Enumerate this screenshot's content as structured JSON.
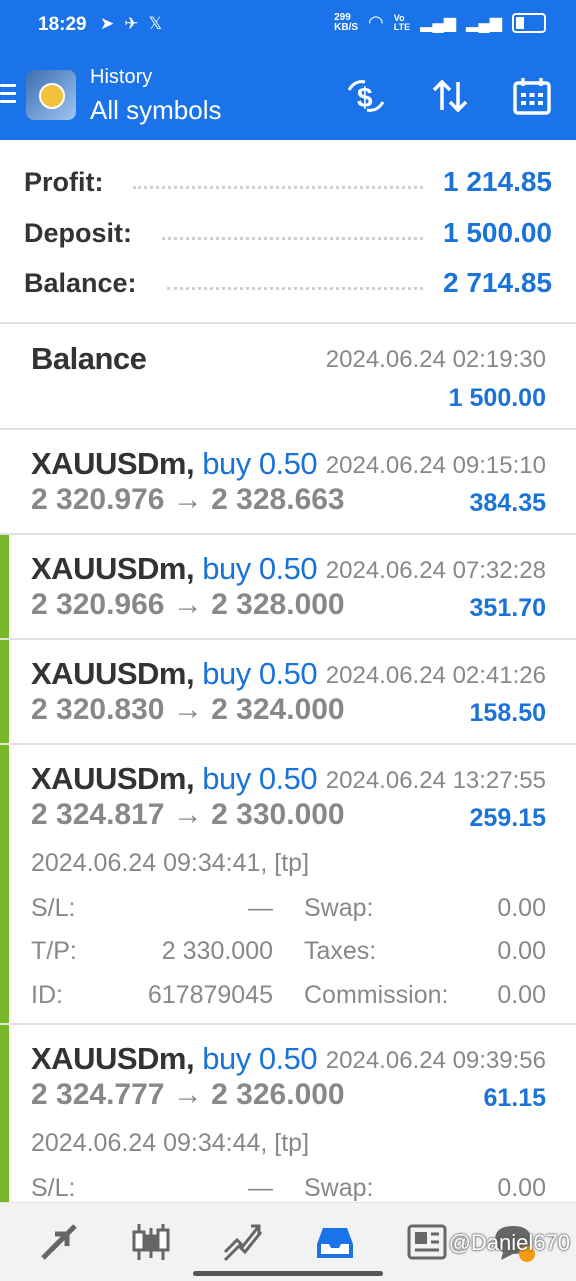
{
  "status_bar": {
    "time": "18:29",
    "net_speed": "299\nKB/S",
    "volte": "Vo\nLTE",
    "app_icons": [
      "telegram-icon",
      "telegram-send-icon",
      "x-icon"
    ]
  },
  "header": {
    "subtitle": "History",
    "title": "All symbols",
    "buttons": [
      "dollar-exchange-icon",
      "sort-icon",
      "calendar-icon"
    ]
  },
  "summary": {
    "profit_label": "Profit:",
    "profit_value": "1 214.85",
    "deposit_label": "Deposit:",
    "deposit_value": "1 500.00",
    "balance_label": "Balance:",
    "balance_value": "2 714.85"
  },
  "balance_entry": {
    "title": "Balance",
    "date": "2024.06.24 02:19:30",
    "amount": "1 500.00"
  },
  "trades": [
    {
      "symbol": "XAUUSDm,",
      "type": "buy 0.50",
      "date": "2024.06.24 09:15:10",
      "open": "2 320.976",
      "arrow": "→",
      "close": "2 328.663",
      "profit": "384.35"
    },
    {
      "symbol": "XAUUSDm,",
      "type": "buy 0.50",
      "date": "2024.06.24 07:32:28",
      "open": "2 320.966",
      "arrow": "→",
      "close": "2 328.000",
      "profit": "351.70"
    },
    {
      "symbol": "XAUUSDm,",
      "type": "buy 0.50",
      "date": "2024.06.24 02:41:26",
      "open": "2 320.830",
      "arrow": "→",
      "close": "2 324.000",
      "profit": "158.50"
    },
    {
      "symbol": "XAUUSDm,",
      "type": "buy 0.50",
      "date": "2024.06.24 13:27:55",
      "open": "2 324.817",
      "arrow": "→",
      "close": "2 330.000",
      "profit": "259.15",
      "close_info": "2024.06.24 09:34:41, [tp]",
      "sl_label": "S/L:",
      "sl_value": "—",
      "swap_label": "Swap:",
      "swap_value": "0.00",
      "tp_label": "T/P:",
      "tp_value": "2 330.000",
      "taxes_label": "Taxes:",
      "taxes_value": "0.00",
      "id_label": "ID:",
      "id_value": "617879045",
      "commission_label": "Commission:",
      "commission_value": "0.00"
    },
    {
      "symbol": "XAUUSDm,",
      "type": "buy 0.50",
      "date": "2024.06.24 09:39:56",
      "open": "2 324.777",
      "arrow": "→",
      "close": "2 326.000",
      "profit": "61.15",
      "close_info": "2024.06.24 09:34:44, [tp]",
      "sl_label": "S/L:",
      "sl_value": "—",
      "swap_label": "Swap:",
      "swap_value": "0.00"
    }
  ],
  "bottom_nav": {
    "items": [
      "quotes-icon",
      "chart-icon",
      "trade-icon",
      "history-icon",
      "news-icon",
      "messages-icon"
    ],
    "active": "history-icon",
    "watermark": "@Daniel670"
  },
  "colors": {
    "accent_blue": "#1a73e8",
    "value_blue": "#1a73d9",
    "trade_bar_green": "#76b82a"
  }
}
